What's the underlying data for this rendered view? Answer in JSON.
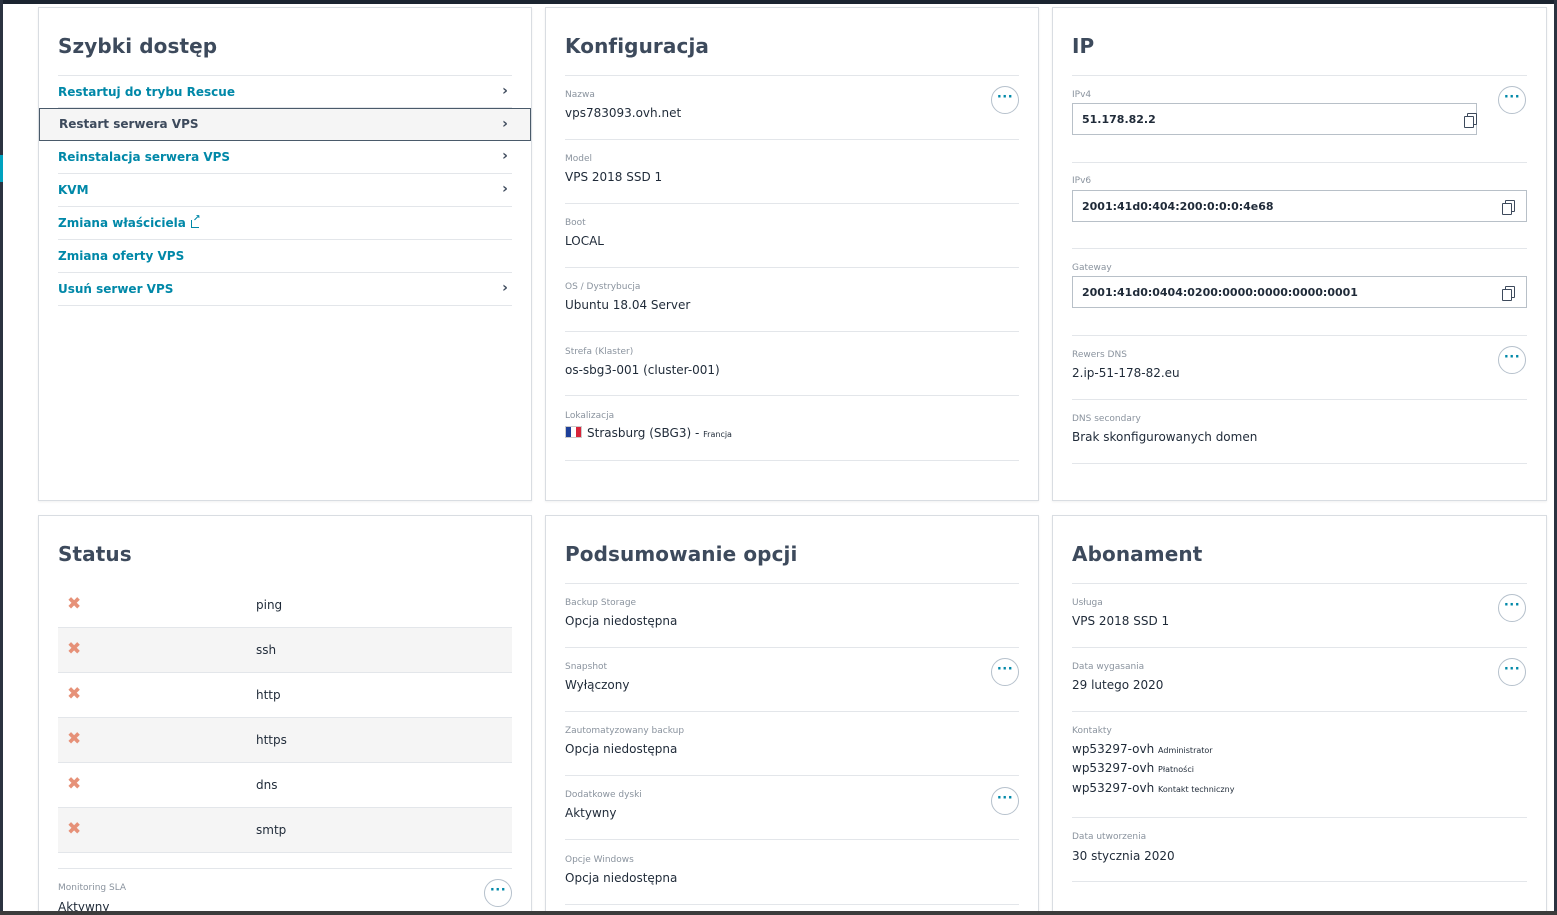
{
  "quick_access": {
    "title": "Szybki dostęp",
    "items": [
      {
        "label": "Restartuj do trybu Rescue"
      },
      {
        "label": "Restart serwera VPS"
      },
      {
        "label": "Reinstalacja serwera VPS"
      },
      {
        "label": "KVM"
      },
      {
        "label": "Zmiana właściciela"
      },
      {
        "label": "Zmiana oferty VPS"
      },
      {
        "label": "Usuń serwer VPS"
      }
    ]
  },
  "configuration": {
    "title": "Konfiguracja",
    "fields": [
      {
        "label": "Nazwa",
        "value": "vps783093.ovh.net"
      },
      {
        "label": "Model",
        "value": "VPS 2018 SSD 1"
      },
      {
        "label": "Boot",
        "value": "LOCAL"
      },
      {
        "label": "OS / Dystrybucja",
        "value": "Ubuntu 18.04 Server"
      },
      {
        "label": "Strefa (Klaster)",
        "value": "os-sbg3-001 (cluster-001)"
      },
      {
        "label": "Lokalizacja",
        "value": "Strasburg (SBG3)",
        "suffix": " - ",
        "country": "Francja"
      }
    ]
  },
  "ip": {
    "title": "IP",
    "ipv4": {
      "label": "IPv4",
      "value": "51.178.82.2"
    },
    "ipv6": {
      "label": "IPv6",
      "value": "2001:41d0:404:200:0:0:0:4e68"
    },
    "gateway": {
      "label": "Gateway",
      "value": "2001:41d0:0404:0200:0000:0000:0000:0001"
    },
    "reverse_dns": {
      "label": "Rewers DNS",
      "value": "2.ip-51-178-82.eu"
    },
    "dns_secondary": {
      "label": "DNS secondary",
      "value": "Brak skonfigurowanych domen"
    }
  },
  "status": {
    "title": "Status",
    "services": [
      "ping",
      "ssh",
      "http",
      "https",
      "dns",
      "smtp"
    ],
    "monitoring": {
      "label": "Monitoring SLA",
      "value": "Aktywny"
    }
  },
  "options": {
    "title": "Podsumowanie opcji",
    "fields": [
      {
        "label": "Backup Storage",
        "value": "Opcja niedostępna"
      },
      {
        "label": "Snapshot",
        "value": "Wyłączony"
      },
      {
        "label": "Zautomatyzowany backup",
        "value": "Opcja niedostępna"
      },
      {
        "label": "Dodatkowe dyski",
        "value": "Aktywny"
      },
      {
        "label": "Opcje Windows",
        "value": "Opcja niedostępna"
      }
    ]
  },
  "subscription": {
    "title": "Abonament",
    "service": {
      "label": "Usługa",
      "value": "VPS 2018 SSD 1"
    },
    "expiry": {
      "label": "Data wygasania",
      "value": "29 lutego 2020"
    },
    "contacts": {
      "label": "Kontakty",
      "items": [
        {
          "name": "wp53297-ovh",
          "role": "Administrator"
        },
        {
          "name": "wp53297-ovh",
          "role": "Płatności"
        },
        {
          "name": "wp53297-ovh",
          "role": "Kontakt techniczny"
        }
      ]
    },
    "created": {
      "label": "Data utworzenia",
      "value": "30 stycznia 2020"
    }
  },
  "more_button_glyph": "···"
}
